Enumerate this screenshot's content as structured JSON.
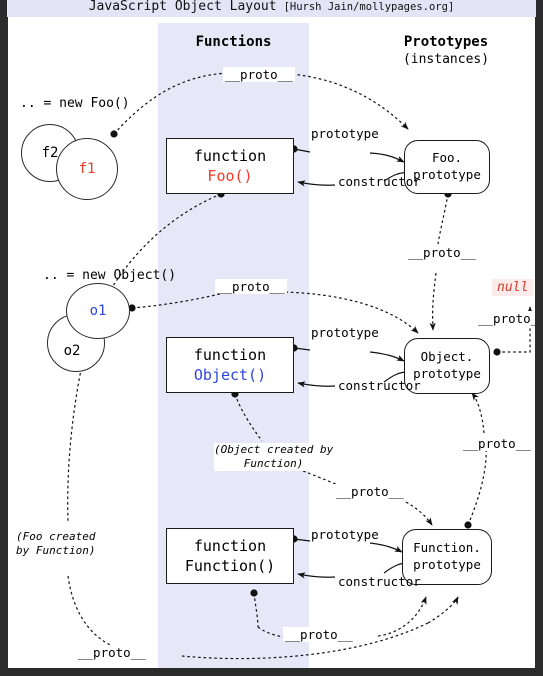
{
  "titlebar": {
    "title": "JavaScript Object Layout",
    "attribution": "[Hursh Jain/mollypages.org]"
  },
  "columns": {
    "functions": "Functions",
    "prototypes_line1": "Prototypes",
    "prototypes_line2": "(instances)"
  },
  "instances": {
    "foo_caption": ".. = new Foo()",
    "foo_circle_back": "f2",
    "foo_circle_front": "f1",
    "object_caption": ".. = new Object()",
    "object_circle_front": "o1",
    "object_circle_back": "o2"
  },
  "function_boxes": [
    {
      "keyword": "function",
      "name": "Foo()",
      "color": "#ef3b2c"
    },
    {
      "keyword": "function",
      "name": "Object()",
      "color": "#2e46e0"
    },
    {
      "keyword": "function",
      "name": "Function()",
      "color": "#000000"
    }
  ],
  "prototype_boxes": [
    {
      "line1": "Foo.",
      "line2": "prototype"
    },
    {
      "line1": "Object.",
      "line2": "prototype"
    },
    {
      "line1": "Function.",
      "line2": "prototype"
    }
  ],
  "edge_labels": {
    "prototype": "prototype",
    "constructor": "constructor",
    "proto": "__proto__"
  },
  "proto_labels": [
    "__proto__",
    "__proto__",
    "__proto__",
    "__proto__",
    "__proto__",
    "__proto__",
    "__proto__",
    "__proto__"
  ],
  "null_value": "null",
  "notes": {
    "object_created": "(Object created by\nFunction)",
    "object_created_l1": "(Object created by",
    "object_created_l2": "Function)",
    "foo_created_l1": "(Foo created",
    "foo_created_l2": "by Function)"
  },
  "colors": {
    "band": "#e6e8f8",
    "titlebar": "#e4e4f6",
    "frame": "#2b2b2b",
    "red": "#ef3b2c",
    "blue": "#2e46e0",
    "null_bg": "#fbeceb",
    "null_fg": "#d83a2a"
  }
}
